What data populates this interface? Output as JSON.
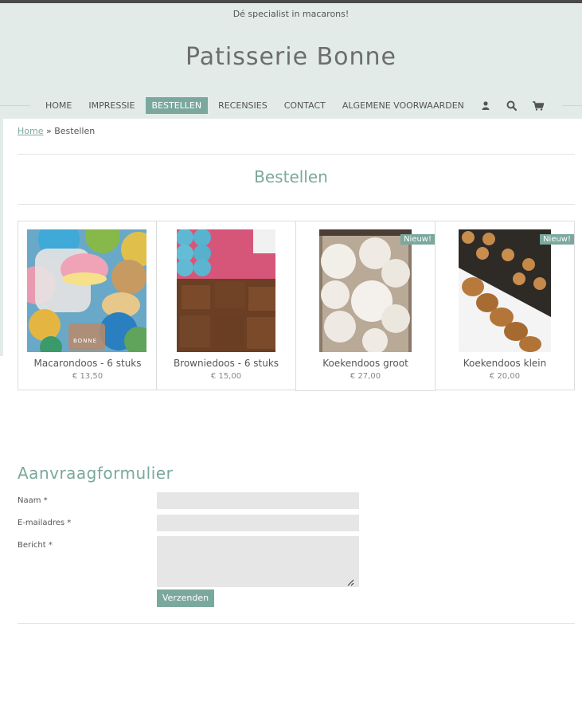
{
  "header": {
    "tagline": "Dé specialist in macarons!",
    "site_title": "Patisserie Bonne"
  },
  "nav": {
    "items": [
      "HOME",
      "IMPRESSIE",
      "BESTELLEN",
      "RECENSIES",
      "CONTACT",
      "ALGEMENE VOORWAARDEN"
    ],
    "active": "BESTELLEN",
    "icons": [
      "user-icon",
      "search-icon",
      "cart-icon"
    ]
  },
  "breadcrumb": {
    "home": "Home",
    "separator": "»",
    "current": "Bestellen"
  },
  "page_title": "Bestellen",
  "products": [
    {
      "name": "Macarondoos - 6 stuks",
      "price": "€ 13,50",
      "badge": ""
    },
    {
      "name": "Browniedoos - 6 stuks",
      "price": "€ 15,00",
      "badge": ""
    },
    {
      "name": "Koekendoos groot",
      "price": "€ 27,00",
      "badge": "Nieuw!"
    },
    {
      "name": "Koekendoos klein",
      "price": "€ 20,00",
      "badge": "Nieuw!"
    }
  ],
  "form": {
    "title": "Aanvraagformulier",
    "name_label": "Naam *",
    "email_label": "E-mailadres *",
    "message_label": "Bericht *",
    "submit_label": "Verzenden"
  },
  "logo_text": "BONNE",
  "colors": {
    "accent": "#7ba89d",
    "header_bg": "#e2ebe8"
  }
}
